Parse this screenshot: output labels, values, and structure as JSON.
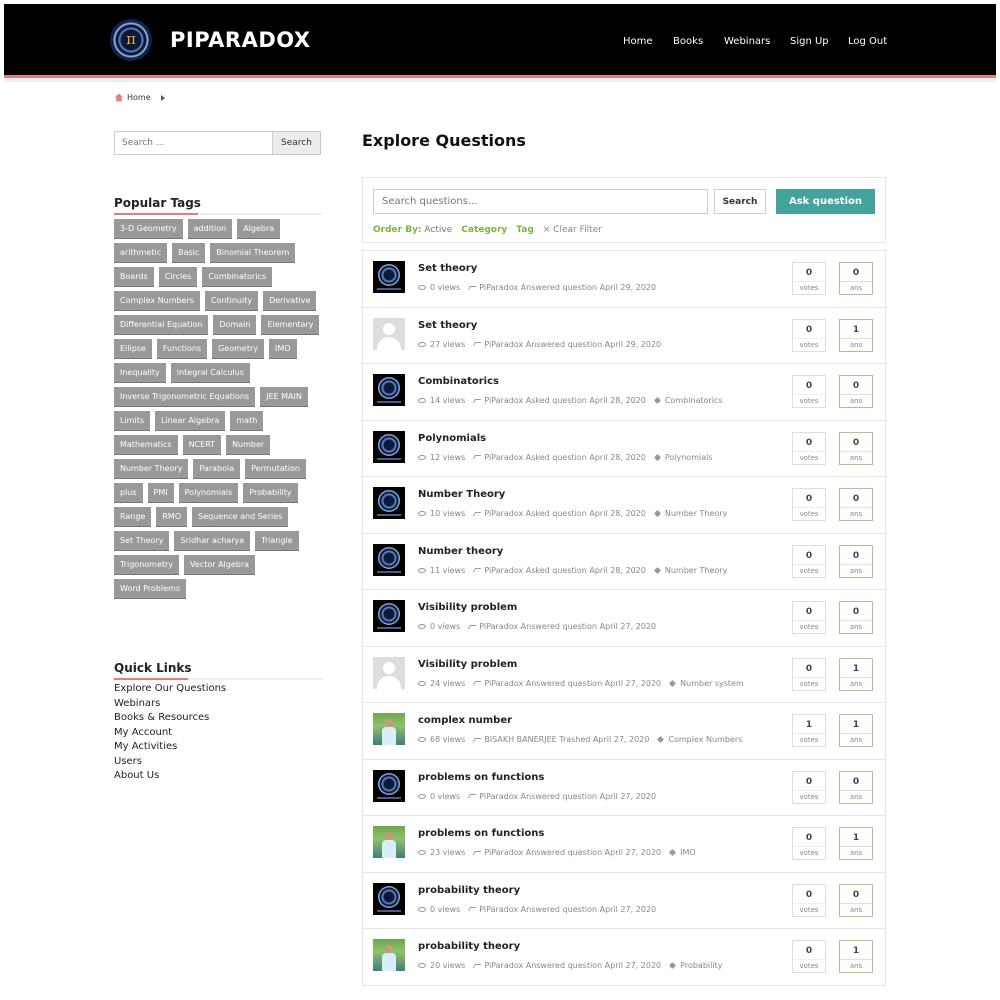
{
  "header": {
    "brand": "PIPARADOX",
    "logo_glyph": "π",
    "nav": [
      "Home",
      "Books",
      "Webinars",
      "Sign Up",
      "Log Out"
    ]
  },
  "breadcrumb": {
    "home": "Home"
  },
  "sidebar": {
    "search": {
      "placeholder": "Search ...",
      "button": "Search"
    },
    "popular_tags_title": "Popular Tags",
    "tags": [
      "3-D Geometry",
      "addition",
      "Algebra",
      "arithmetic",
      "Basic",
      "Binomial Theorem",
      "Boards",
      "Circles",
      "Combinatorics",
      "Complex Numbers",
      "Continuity",
      "Derivative",
      "Differential Equation",
      "Domain",
      "Elementary",
      "Ellipse",
      "Functions",
      "Geometry",
      "IMO",
      "Inequality",
      "Integral Calculus",
      "Inverse Trigonometric Equations",
      "JEE MAIN",
      "Limits",
      "Linear Algebra",
      "math",
      "Mathematics",
      "NCERT",
      "Number",
      "Number Theory",
      "Parabola",
      "Permutation",
      "plus",
      "PMI",
      "Polynomials",
      "Probability",
      "Range",
      "RMO",
      "Sequence and Series",
      "Set Theory",
      "Sridhar acharya",
      "Triangle",
      "Trigonometry",
      "Vector Algebra",
      "Word Problems"
    ],
    "quick_links_title": "Quick Links",
    "quick_links": [
      "Explore Our Questions",
      "Webinars",
      "Books & Resources",
      "My Account",
      "My Activities",
      "Users",
      "About Us"
    ]
  },
  "main": {
    "title": "Explore Questions",
    "search_placeholder": "Search questions...",
    "search_button": "Search",
    "ask_button": "Ask question",
    "order_by_label": "Order By:",
    "order_by_value": "Active",
    "category_label": "Category",
    "tag_label": "Tag",
    "clear_filter": "× Clear Filter",
    "votes_label": "votes",
    "ans_label": "ans",
    "questions": [
      {
        "title": "Set theory",
        "avatar": "logo",
        "views": "0 views",
        "activity": "PiParadox Answered question April 29, 2020",
        "tag": "",
        "votes": "0",
        "answers": "0"
      },
      {
        "title": "Set theory",
        "avatar": "default",
        "views": "27 views",
        "activity": "PiParadox Answered question April 29, 2020",
        "tag": "",
        "votes": "0",
        "answers": "1"
      },
      {
        "title": "Combinatorics",
        "avatar": "logo",
        "views": "14 views",
        "activity": "PiParadox Asked question April 28, 2020",
        "tag": "Combinatorics",
        "votes": "0",
        "answers": "0"
      },
      {
        "title": "Polynomials",
        "avatar": "logo",
        "views": "12 views",
        "activity": "PiParadox Asked question April 28, 2020",
        "tag": "Polynomials",
        "votes": "0",
        "answers": "0"
      },
      {
        "title": "Number Theory",
        "avatar": "logo",
        "views": "10 views",
        "activity": "PiParadox Asked question April 28, 2020",
        "tag": "Number Theory",
        "votes": "0",
        "answers": "0"
      },
      {
        "title": "Number theory",
        "avatar": "logo",
        "views": "11 views",
        "activity": "PiParadox Asked question April 28, 2020",
        "tag": "Number Theory",
        "votes": "0",
        "answers": "0"
      },
      {
        "title": "Visibility problem",
        "avatar": "logo",
        "views": "0 views",
        "activity": "PiParadox Answered question April 27, 2020",
        "tag": "",
        "votes": "0",
        "answers": "0"
      },
      {
        "title": "Visibility problem",
        "avatar": "default",
        "views": "24 views",
        "activity": "PiParadox Answered question April 27, 2020",
        "tag": "Number system",
        "votes": "0",
        "answers": "1"
      },
      {
        "title": "complex number",
        "avatar": "photo",
        "views": "68 views",
        "activity": "BISAKH BANERJEE Trashed April 27, 2020",
        "tag": "Complex Numbers",
        "votes": "1",
        "answers": "1"
      },
      {
        "title": "problems on functions",
        "avatar": "logo",
        "views": "0 views",
        "activity": "PiParadox Answered question April 27, 2020",
        "tag": "",
        "votes": "0",
        "answers": "0"
      },
      {
        "title": "problems on functions",
        "avatar": "photo",
        "views": "23 views",
        "activity": "PiParadox Answered question April 27, 2020",
        "tag": "IMO",
        "votes": "0",
        "answers": "1"
      },
      {
        "title": "probability theory",
        "avatar": "logo",
        "views": "0 views",
        "activity": "PiParadox Answered question April 27, 2020",
        "tag": "",
        "votes": "0",
        "answers": "0"
      },
      {
        "title": "probability theory",
        "avatar": "photo",
        "views": "20 views",
        "activity": "PiParadox Answered question April 27, 2020",
        "tag": "Probability",
        "votes": "0",
        "answers": "1"
      }
    ]
  },
  "colors": {
    "accent": "#44a39c",
    "brand_line": "#e87c7c",
    "filter_green": "#7cb342",
    "tag_bg": "#999999"
  }
}
